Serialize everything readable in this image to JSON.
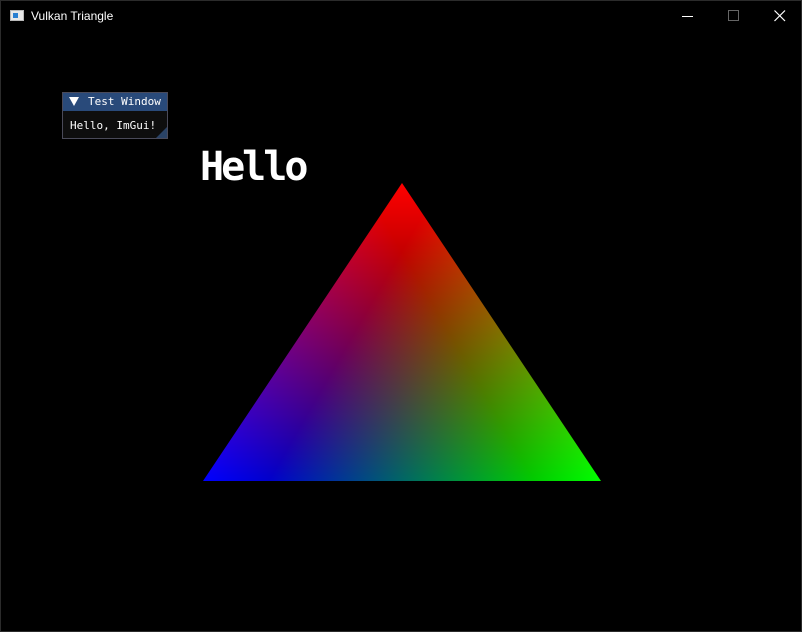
{
  "window": {
    "title": "Vulkan Triangle",
    "icon": "window-app-icon",
    "controls": [
      "minimize-icon",
      "maximize-icon",
      "close-icon"
    ]
  },
  "scene": {
    "overlay_text": "Hello",
    "triangle": {
      "vertex_colors": {
        "top": "#ff0000",
        "bottom_left": "#0000ff",
        "bottom_right": "#00ff00"
      }
    },
    "background": "#000000"
  },
  "imgui_window": {
    "title": "Test Window",
    "body_text": "Hello, ImGui!",
    "collapse_icon": "triangle-down-icon",
    "title_bg": "#294a7a"
  }
}
